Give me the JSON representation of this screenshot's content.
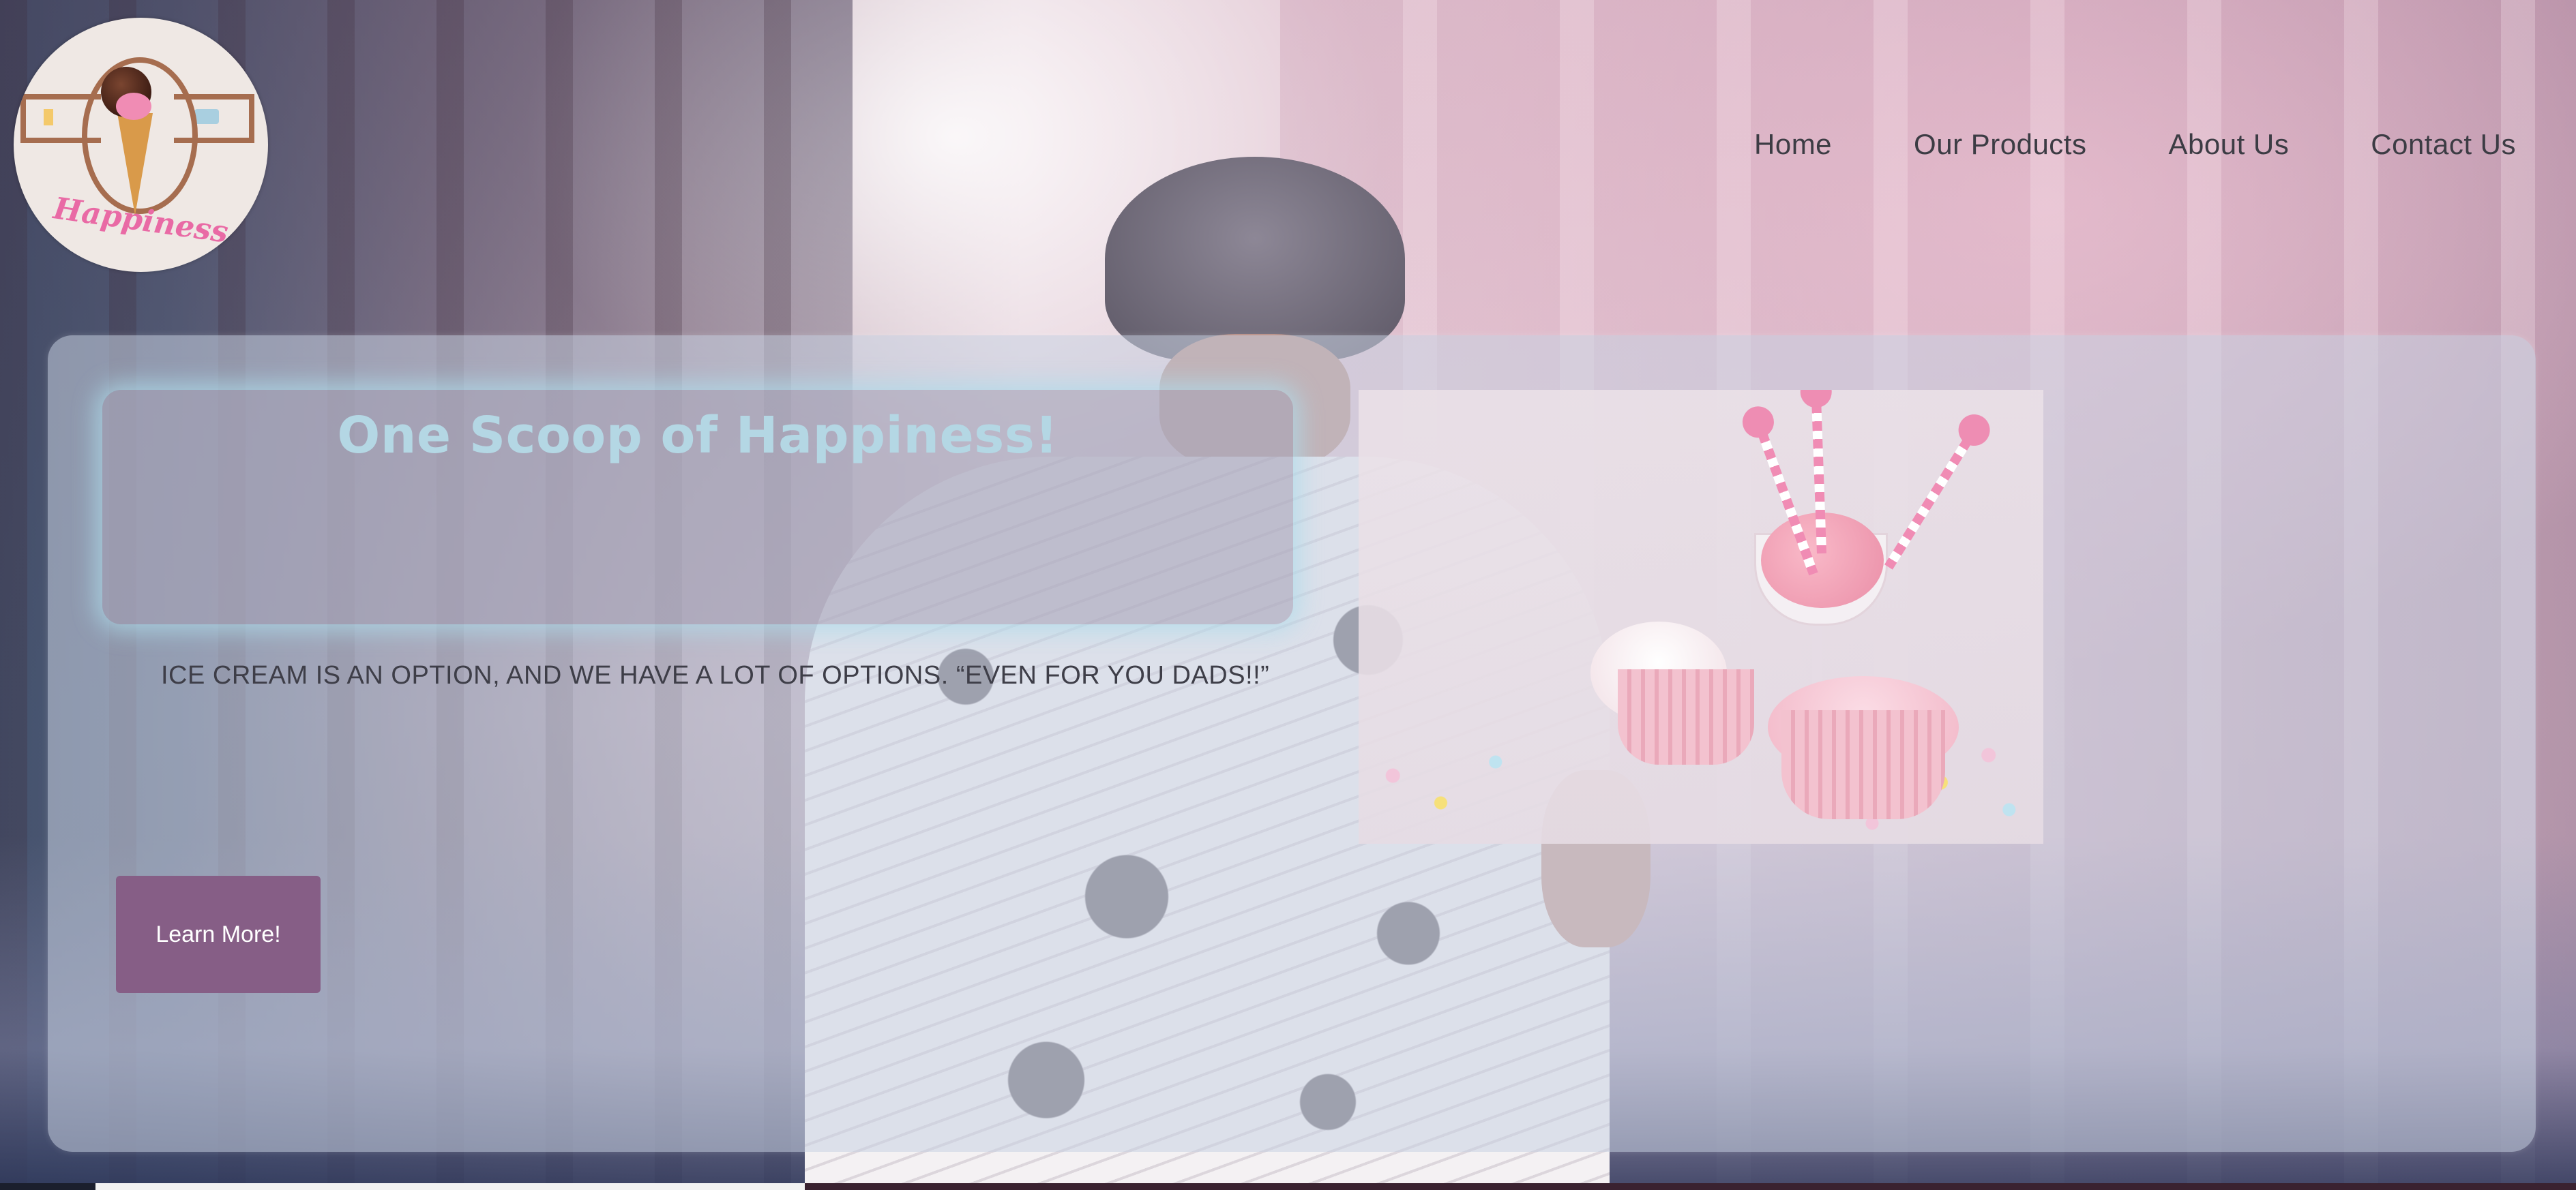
{
  "logo": {
    "wordmark": "Happiness"
  },
  "nav": {
    "items": [
      {
        "label": "Home"
      },
      {
        "label": "Our Products"
      },
      {
        "label": "About Us"
      },
      {
        "label": "Contact Us"
      }
    ]
  },
  "hero": {
    "title": "One Scoop of Happiness!",
    "tagline": "ICE CREAM IS AN OPTION, AND WE HAVE A LOT OF OPTIONS. “EVEN FOR YOU DADS!!”",
    "cta_label": "Learn More!"
  },
  "colors": {
    "cta_background": "#865e86",
    "title_color": "#b4d7e4",
    "title_glow": "#addceb",
    "nav_text": "#3c3c44"
  }
}
